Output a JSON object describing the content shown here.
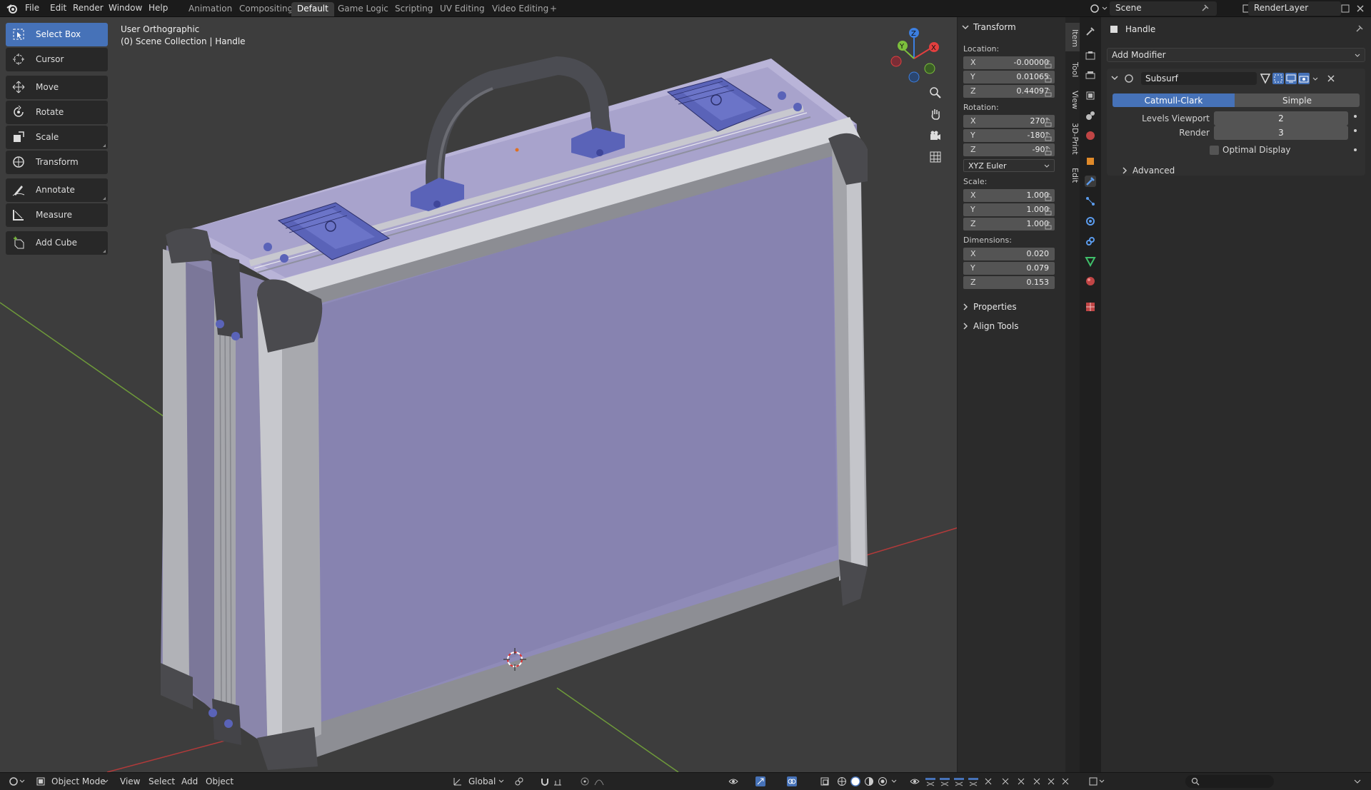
{
  "topbar": {
    "menus": [
      "File",
      "Edit",
      "Render",
      "Window",
      "Help"
    ],
    "workspaces": [
      "Animation",
      "Compositing",
      "Default",
      "Game Logic",
      "Scripting",
      "UV Editing",
      "Video Editing",
      "+"
    ],
    "active_workspace": "Default",
    "scene": "Scene",
    "render_layer": "RenderLayer"
  },
  "viewport": {
    "view_name": "User Orthographic",
    "collection_path": "(0) Scene Collection | Handle"
  },
  "toolbar": {
    "tools": [
      {
        "label": "Select Box",
        "icon": "select-box-icon",
        "active": true
      },
      {
        "label": "Cursor",
        "icon": "cursor-icon"
      },
      {
        "label": "Move",
        "icon": "move-icon"
      },
      {
        "label": "Rotate",
        "icon": "rotate-icon"
      },
      {
        "label": "Scale",
        "icon": "scale-icon"
      },
      {
        "label": "Transform",
        "icon": "transform-icon"
      },
      {
        "label": "Annotate",
        "icon": "annotate-icon"
      },
      {
        "label": "Measure",
        "icon": "measure-icon"
      },
      {
        "label": "Add Cube",
        "icon": "add-cube-icon"
      }
    ]
  },
  "gizmo": {
    "x": "X",
    "y": "Y",
    "z": "Z"
  },
  "npanel": {
    "section_title": "Transform",
    "location_label": "Location:",
    "location": {
      "x": "-0.00000",
      "y": "0.01065",
      "z": "0.44097"
    },
    "rotation_label": "Rotation:",
    "rotation": {
      "x": "270°",
      "y": "-180°",
      "z": "-90°"
    },
    "rotation_mode": "XYZ Euler",
    "scale_label": "Scale:",
    "scale": {
      "x": "1.000",
      "y": "1.000",
      "z": "1.000"
    },
    "dimensions_label": "Dimensions:",
    "dimensions": {
      "x": "0.020",
      "y": "0.079",
      "z": "0.153"
    },
    "axis_labels": {
      "x": "X",
      "y": "Y",
      "z": "Z"
    },
    "properties": "Properties",
    "align_tools": "Align Tools"
  },
  "vtabs": [
    "Item",
    "Tool",
    "View",
    "3D-Print",
    "Edit"
  ],
  "properties_editor": {
    "object_name": "Handle",
    "add_modifier": "Add Modifier",
    "modifier_name": "Subsurf",
    "subdiv_types": [
      "Catmull-Clark",
      "Simple"
    ],
    "active_subdiv_type": "Catmull-Clark",
    "levels_viewport_label": "Levels Viewport",
    "levels_viewport": "2",
    "render_label": "Render",
    "render": "3",
    "optimal_display": "Optimal Display",
    "advanced": "Advanced"
  },
  "bottombar": {
    "mode": "Object Mode",
    "menus": [
      "View",
      "Select",
      "Add",
      "Object"
    ],
    "orientation": "Global"
  },
  "colors": {
    "accent": "#4672b8",
    "case_panel": "#8d89b5",
    "frame": "#a7a8ab",
    "hardware": "#5a63b8",
    "axis_x": "#e23f3f",
    "axis_y": "#7cbf3c",
    "axis_z": "#3c7fe0"
  }
}
